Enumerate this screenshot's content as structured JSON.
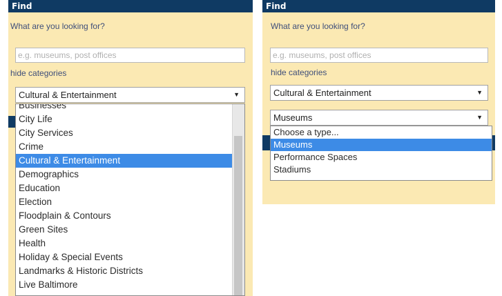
{
  "left": {
    "header": "Find",
    "prompt": "What are you looking for?",
    "search_placeholder": "e.g. museums, post offices",
    "hide_link": "hide categories",
    "category_select": "Cultural & Entertainment",
    "category_options": [
      "Businesses",
      "City Life",
      "City Services",
      "Crime",
      "Cultural & Entertainment",
      "Demographics",
      "Education",
      "Election",
      "Floodplain & Contours",
      "Green Sites",
      "Health",
      "Holiday & Special Events",
      "Landmarks & Historic Districts",
      "Live Baltimore"
    ],
    "selected_index": 4
  },
  "right": {
    "header": "Find",
    "prompt": "What are you looking for?",
    "search_placeholder": "e.g. museums, post offices",
    "hide_link": "hide categories",
    "category_select": "Cultural & Entertainment",
    "type_select": "Museums",
    "type_options": [
      "Choose a type...",
      "Museums",
      "Performance Spaces",
      "Stadiums"
    ],
    "selected_index": 1
  },
  "icons": {
    "dropdown_arrow": "chevron-down-icon"
  },
  "colors": {
    "header_bg": "#0f3a63",
    "panel_bg": "#fbe9b3",
    "selection": "#3d8be6"
  }
}
